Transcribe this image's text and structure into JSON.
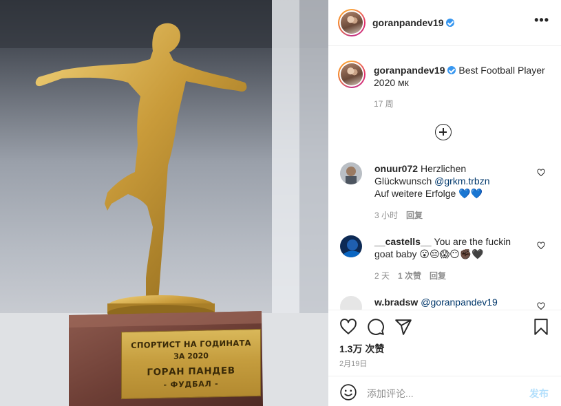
{
  "photo": {
    "plaque": {
      "line1": "СПОРТИСТ НА ГОДИНАТА",
      "line2": "ЗА 2020",
      "line3": "ГОРАН ПАНДЕВ",
      "line4": "- ФУДБАЛ -"
    }
  },
  "header": {
    "username": "goranpandev19",
    "more_icon": "more-horizontal-icon"
  },
  "caption": {
    "username": "goranpandev19",
    "text": "Best Football Player 2020 мк",
    "time": "17 周"
  },
  "load_more_icon": "plus-circle-icon",
  "comments": [
    {
      "username": "onuur072",
      "text_before": "Herzlichen Glückwunsch ",
      "mention": "@grkm.trbzn",
      "text_after": " Auf weitere Erfolge 💙💙",
      "time": "3 小时",
      "reply": "回复",
      "likes": ""
    },
    {
      "username": "__castells__",
      "text_before": "You are the fuckin goat baby 😮😔😱😶✊🏿🖤",
      "mention": "",
      "text_after": "",
      "time": "2 天",
      "likes": "1 次赞",
      "reply": "回复"
    },
    {
      "username": "w.bradsw",
      "text_before": "",
      "mention": "@goranpandev19",
      "text_after": "",
      "time": "",
      "likes": "",
      "reply": ""
    }
  ],
  "actions": {
    "like_icon": "heart-icon",
    "comment_icon": "comment-icon",
    "share_icon": "paper-plane-icon",
    "save_icon": "bookmark-icon",
    "likes_count": "1.3万 次赞",
    "date": "2月19日"
  },
  "add_comment": {
    "emoji_icon": "emoji-icon",
    "placeholder": "添加评论...",
    "post_label": "发布"
  },
  "colors": {
    "verified": "#3897f0",
    "mention": "#00376b",
    "post_disabled": "#b2dffc",
    "muted": "#8e8e8e"
  }
}
